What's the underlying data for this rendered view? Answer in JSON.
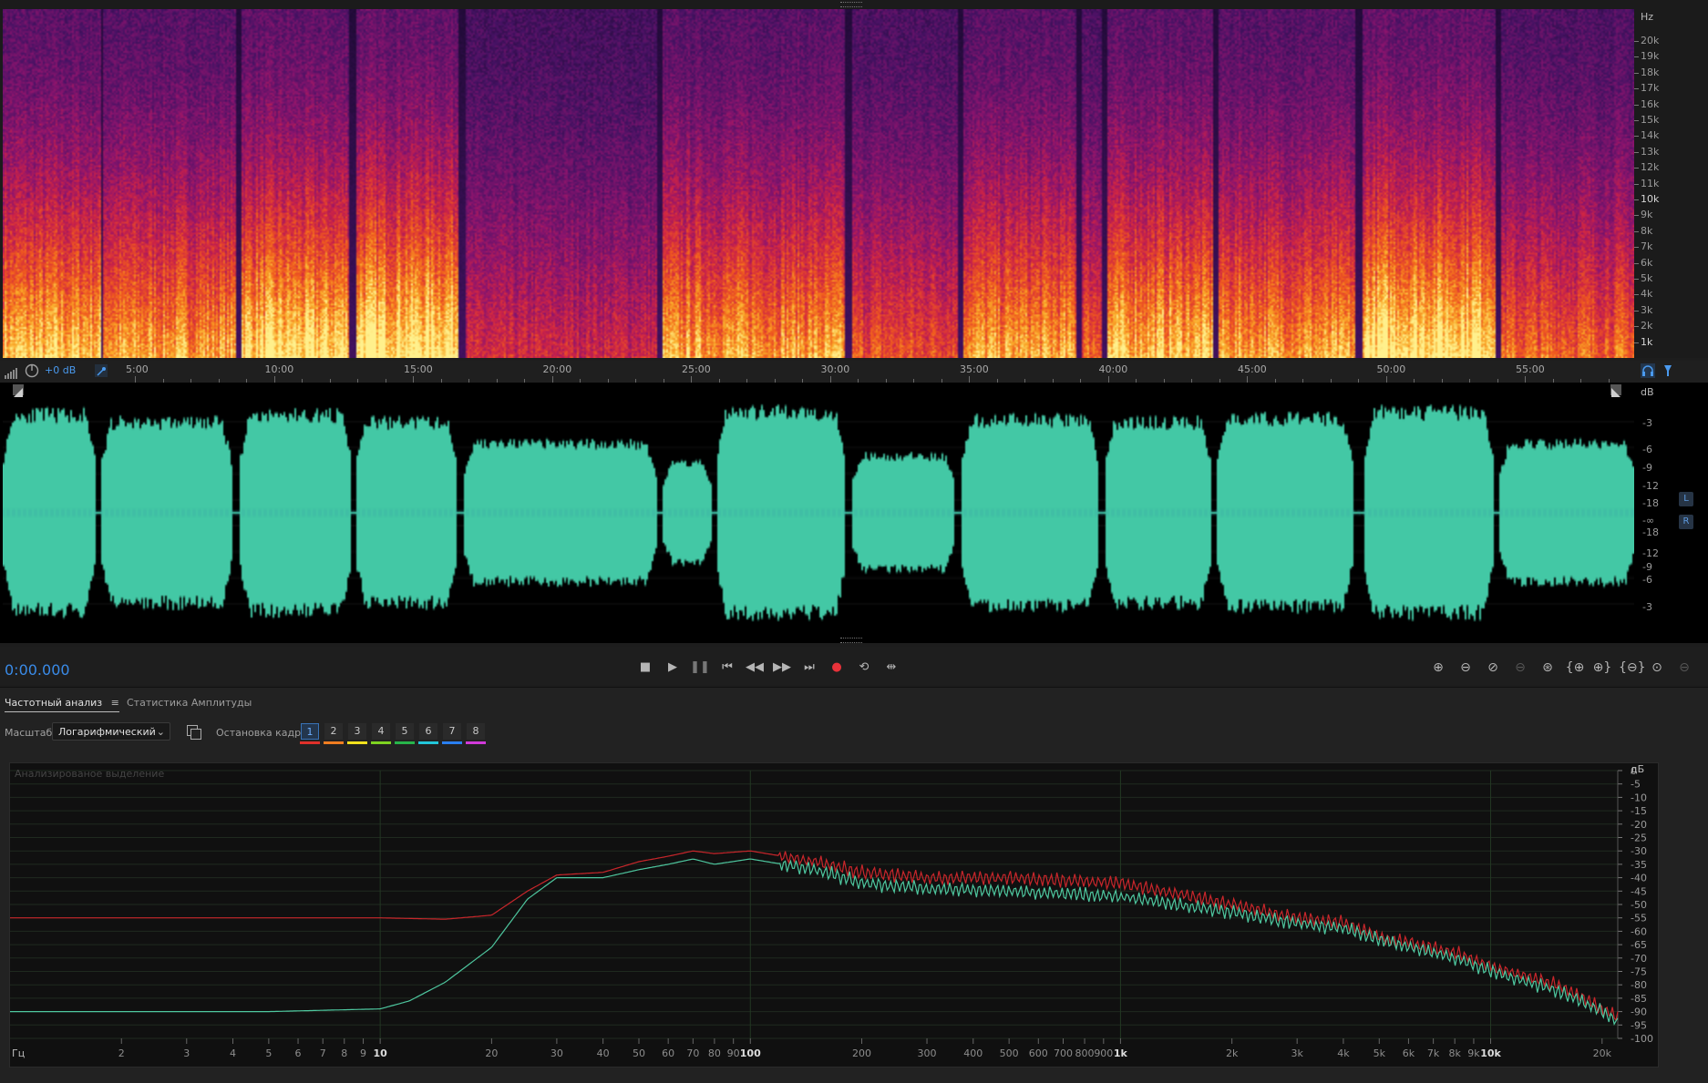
{
  "spectrogram": {
    "unit_label": "Hz",
    "freq_labels": [
      {
        "label": "20k",
        "bold": false
      },
      {
        "label": "19k",
        "bold": false
      },
      {
        "label": "18k",
        "bold": false
      },
      {
        "label": "17k",
        "bold": false
      },
      {
        "label": "16k",
        "bold": false
      },
      {
        "label": "15k",
        "bold": false
      },
      {
        "label": "14k",
        "bold": false
      },
      {
        "label": "13k",
        "bold": false
      },
      {
        "label": "12k",
        "bold": false
      },
      {
        "label": "11k",
        "bold": false
      },
      {
        "label": "10k",
        "bold": true
      },
      {
        "label": "9k",
        "bold": false
      },
      {
        "label": "8k",
        "bold": false
      },
      {
        "label": "7k",
        "bold": false
      },
      {
        "label": "6k",
        "bold": false
      },
      {
        "label": "5k",
        "bold": false
      },
      {
        "label": "4k",
        "bold": false
      },
      {
        "label": "3k",
        "bold": false
      },
      {
        "label": "2k",
        "bold": false
      },
      {
        "label": "1k",
        "bold": true
      }
    ]
  },
  "ruler": {
    "gain_label": "+0 dB",
    "time_labels": [
      "5:00",
      "10:00",
      "15:00",
      "20:00",
      "25:00",
      "30:00",
      "35:00",
      "40:00",
      "45:00",
      "50:00",
      "55:00"
    ]
  },
  "waveform": {
    "unit_label": "dB",
    "db_labels": [
      "-3",
      "-6",
      "-9",
      "-12",
      "-18",
      "-∞",
      "-18",
      "-12",
      "-9",
      "-6",
      "-3"
    ],
    "left_channel": "L",
    "right_channel": "R",
    "color": "#43c8a5"
  },
  "transport": {
    "timecode": "0:00.000",
    "buttons": [
      "stop",
      "play",
      "pause",
      "skip-start",
      "rewind",
      "fast-forward",
      "skip-end",
      "record",
      "loop",
      "skip-selection"
    ],
    "zoom_buttons": [
      "zoom-in-amplitude",
      "zoom-out-amplitude",
      "zoom-reset-amplitude",
      "zoom-disabled",
      "zoom-in-center",
      "zoom-in-left",
      "zoom-in-right",
      "zoom-out-full",
      "zoom-selection",
      "zoom-full-disabled"
    ]
  },
  "panel": {
    "tabs": [
      {
        "label": "Частотный анализ",
        "active": true
      },
      {
        "label": "Статистика Амплитуды",
        "active": false
      }
    ],
    "scale_label": "Масштаб:",
    "scale_value": "Логарифмический",
    "freeze_label": "Остановка кадра:",
    "frames": [
      {
        "label": "1",
        "color": "#e0302a"
      },
      {
        "label": "2",
        "color": "#f07d21"
      },
      {
        "label": "3",
        "color": "#f2e11d"
      },
      {
        "label": "4",
        "color": "#7ed321"
      },
      {
        "label": "5",
        "color": "#27b54a"
      },
      {
        "label": "6",
        "color": "#22c6d9"
      },
      {
        "label": "7",
        "color": "#2a7ff0"
      },
      {
        "label": "8",
        "color": "#d13ad9"
      }
    ],
    "selected_frame": "1"
  },
  "chart_data": {
    "type": "line",
    "title": "Анализированое выделение",
    "xlabel": "Гц",
    "ylabel": "дБ",
    "x_scale": "log",
    "xlim": [
      1,
      22050
    ],
    "ylim": [
      -100,
      0
    ],
    "x_ticks": [
      2,
      3,
      4,
      5,
      6,
      7,
      8,
      9,
      10,
      20,
      30,
      40,
      50,
      60,
      70,
      80,
      90,
      100,
      200,
      300,
      400,
      500,
      600,
      700,
      800,
      900,
      1000,
      2000,
      3000,
      4000,
      5000,
      6000,
      7000,
      8000,
      9000,
      10000,
      20000
    ],
    "x_tick_labels": [
      "2",
      "3",
      "4",
      "5",
      "6",
      "7",
      "8",
      "9",
      "10",
      "20",
      "30",
      "40",
      "50",
      "60",
      "70",
      "80",
      "90",
      "100",
      "200",
      "300",
      "400",
      "500",
      "600",
      "700",
      "800",
      "900",
      "1k",
      "2k",
      "3k",
      "4k",
      "5k",
      "6k",
      "7k",
      "8k",
      "9k",
      "10k",
      "20k"
    ],
    "y_ticks": [
      0,
      -5,
      -10,
      -15,
      -20,
      -25,
      -30,
      -35,
      -40,
      -45,
      -50,
      -55,
      -60,
      -65,
      -70,
      -75,
      -80,
      -85,
      -90,
      -95,
      -100
    ],
    "series": [
      {
        "color": "#c8262b",
        "x": [
          1,
          5,
          10,
          15,
          20,
          25,
          30,
          40,
          50,
          60,
          70,
          80,
          100,
          150,
          200,
          300,
          500,
          1000,
          2000,
          3000,
          4000,
          5000,
          8000,
          10000,
          15000,
          20000,
          22000
        ],
        "y": [
          -55,
          -55,
          -55,
          -55.5,
          -54,
          -45,
          -39,
          -38,
          -34,
          -32,
          -30,
          -31,
          -30,
          -34,
          -38,
          -40,
          -40,
          -42,
          -50,
          -55,
          -57,
          -62,
          -68,
          -73,
          -80,
          -89,
          -92
        ]
      },
      {
        "color": "#4ec79f",
        "x": [
          1,
          5,
          10,
          12,
          15,
          20,
          25,
          30,
          40,
          50,
          60,
          70,
          80,
          100,
          150,
          200,
          300,
          500,
          1000,
          2000,
          3000,
          4000,
          5000,
          8000,
          10000,
          15000,
          20000,
          22000
        ],
        "y": [
          -90,
          -90,
          -89,
          -86,
          -79,
          -66,
          -48,
          -40,
          -40,
          -37,
          -35,
          -33,
          -35,
          -33,
          -37,
          -42,
          -44,
          -45,
          -47,
          -53,
          -57,
          -59,
          -63,
          -70,
          -75,
          -82,
          -90,
          -94
        ]
      }
    ]
  }
}
